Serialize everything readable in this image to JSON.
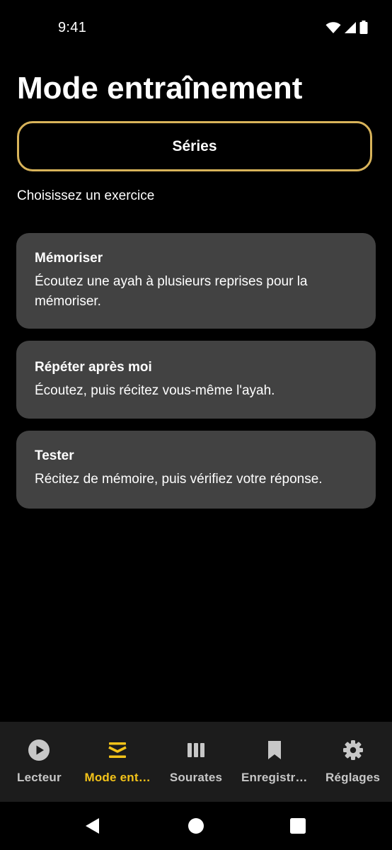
{
  "status_bar": {
    "time": "9:41",
    "icons": [
      "wifi-icon",
      "cell-signal-icon",
      "battery-icon"
    ]
  },
  "page": {
    "title": "Mode entraînement",
    "series_button_label": "Séries",
    "section_label": "Choisissez un exercice"
  },
  "exercises": [
    {
      "title": "Mémoriser",
      "description": "Écoutez une ayah à plusieurs reprises pour la mémoriser."
    },
    {
      "title": "Répéter après moi",
      "description": "Écoutez, puis récitez vous-même l'ayah."
    },
    {
      "title": "Tester",
      "description": "Récitez de mémoire, puis vérifiez votre réponse."
    }
  ],
  "bottom_nav": {
    "active_index": 1,
    "items": [
      {
        "label": "Lecteur",
        "icon": "play-circle-icon"
      },
      {
        "label": "Mode ent…",
        "icon": "training-stack-icon"
      },
      {
        "label": "Sourates",
        "icon": "library-icon"
      },
      {
        "label": "Enregistr…",
        "icon": "bookmark-icon"
      },
      {
        "label": "Réglages",
        "icon": "gear-icon"
      }
    ]
  },
  "system_nav": {
    "icons": [
      "back-icon",
      "home-icon",
      "recents-icon"
    ]
  },
  "colors": {
    "background": "#000000",
    "card": "#424242",
    "accent": "#f3c319",
    "button_border": "#d8b35a",
    "nav_background": "#1c1c1c",
    "nav_inactive": "#c7c7c7"
  }
}
